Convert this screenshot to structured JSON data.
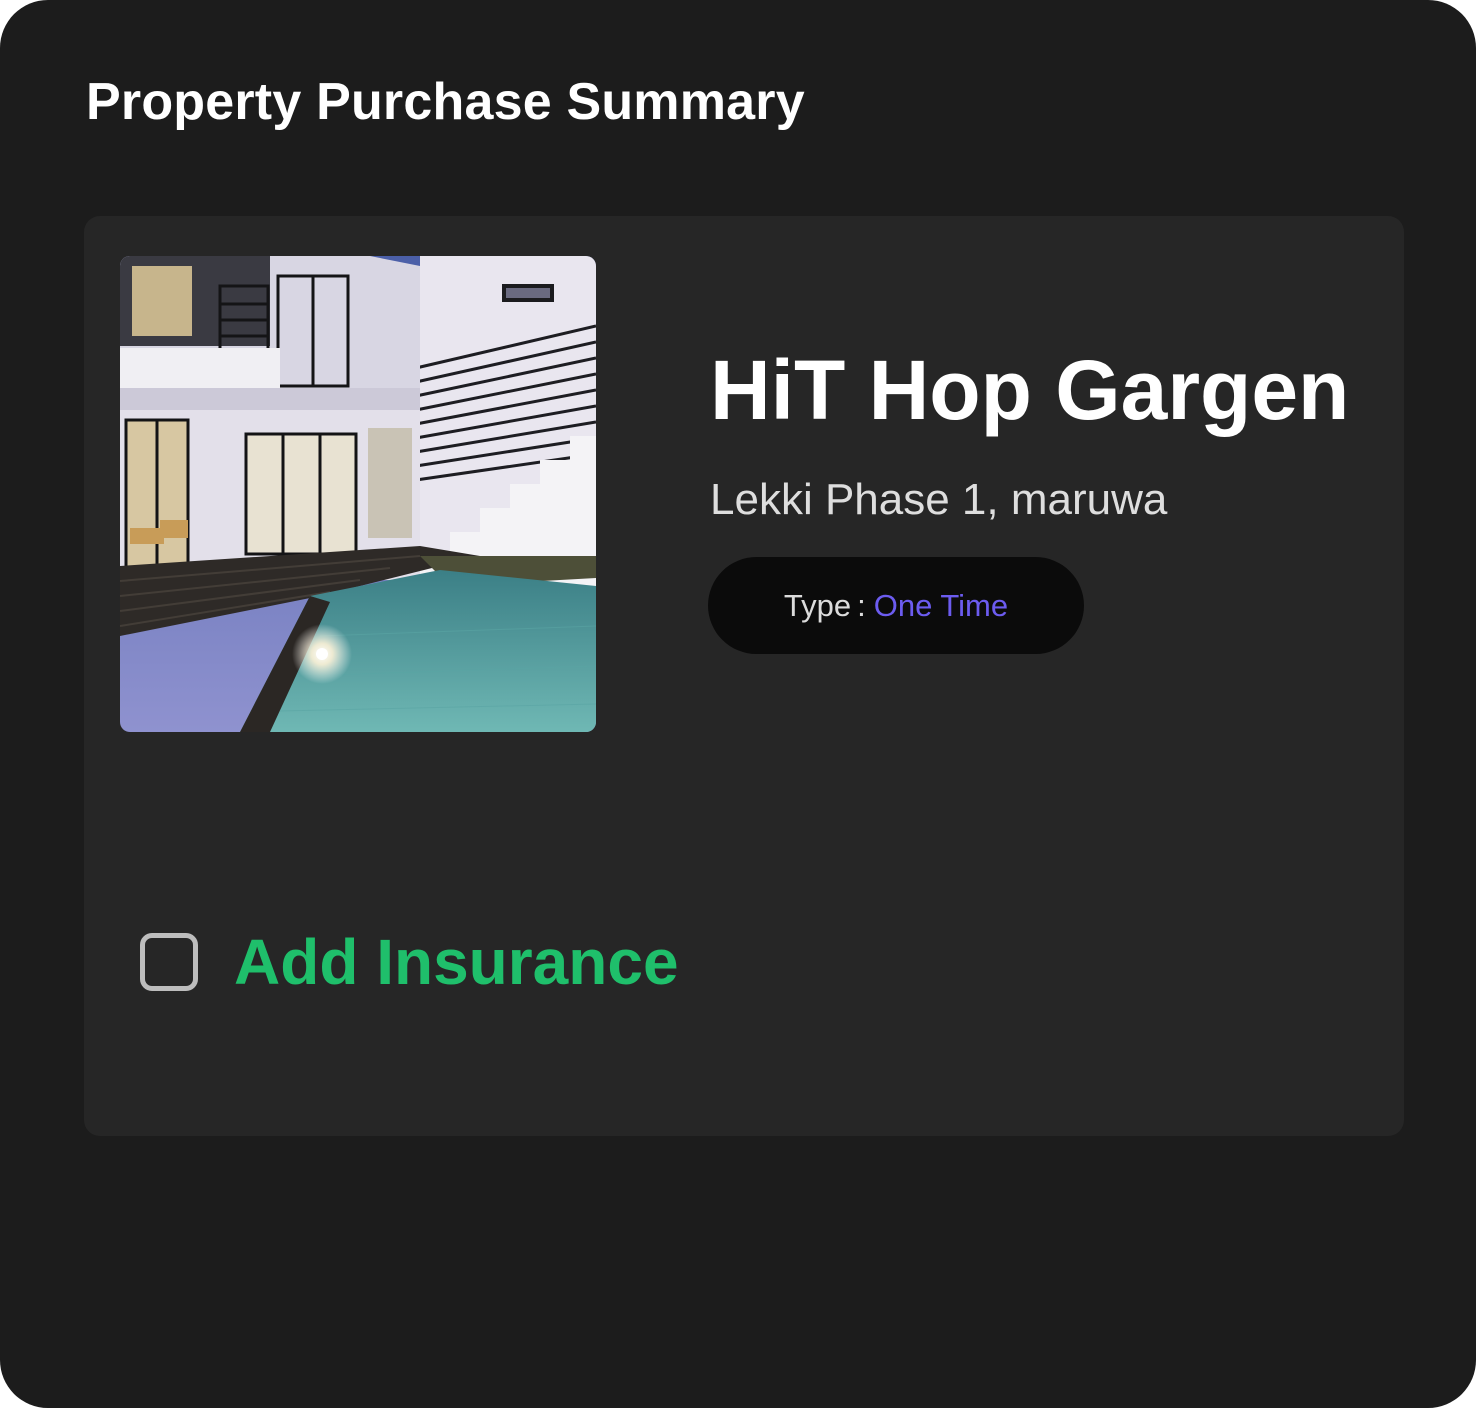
{
  "summary": {
    "title": "Property Purchase Summary"
  },
  "property": {
    "image_icon": "property-photo",
    "name": "HiT Hop Gargen",
    "location": "Lekki Phase 1, maruwa",
    "type_label": "Type",
    "type_separator": ":",
    "type_value": "One Time"
  },
  "insurance": {
    "label": "Add Insurance",
    "checked": false
  },
  "colors": {
    "panel_background": "#1c1c1c",
    "card_background": "#262626",
    "pill_background": "#0b0b0b",
    "type_value": "#6c5cf0",
    "insurance_label": "#1fbf6b"
  }
}
